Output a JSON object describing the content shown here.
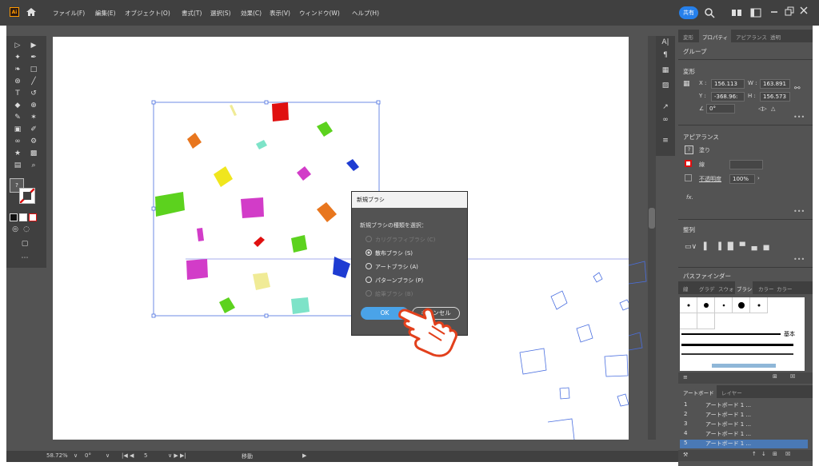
{
  "menubar": {
    "logo": "Ai",
    "items": [
      "ファイル(F)",
      "編集(E)",
      "オブジェクト(O)",
      "書式(T)",
      "選択(S)",
      "効果(C)",
      "表示(V)",
      "ウィンドウ(W)",
      "ヘルプ(H)"
    ],
    "share_label": "共有"
  },
  "dialog": {
    "title": "新規ブラシ",
    "prompt": "新規ブラシの種類を選択：",
    "options": [
      {
        "label": "カリグラフィブラシ (C)",
        "enabled": false,
        "selected": false
      },
      {
        "label": "散布ブラシ (S)",
        "enabled": true,
        "selected": true
      },
      {
        "label": "アートブラシ (A)",
        "enabled": true,
        "selected": false
      },
      {
        "label": "パターンブラシ (P)",
        "enabled": true,
        "selected": false
      },
      {
        "label": "絵筆ブラシ (B)",
        "enabled": false,
        "selected": false
      }
    ],
    "ok_label": "OK",
    "cancel_label": "キャンセル"
  },
  "properties_panel": {
    "tabs": [
      "変形",
      "プロパティ",
      "アピアランス",
      "透明"
    ],
    "active_tab": "プロパティ",
    "group_label": "グループ",
    "transform_title": "変形",
    "x_label": "X :",
    "x_value": "156.113",
    "y_label": "Y :",
    "y_value": "-368.96:",
    "w_label": "W :",
    "w_value": "163.891",
    "h_label": "H :",
    "h_value": "156.573",
    "angle_value": "0°",
    "appearance_title": "アピアランス",
    "fill_label": "塗り",
    "stroke_label": "線",
    "opacity_label": "不透明度",
    "opacity_value": "100%",
    "fx_label": "fx.",
    "align_title": "整列",
    "pathfinder_title": "パスファインダー"
  },
  "brush_panel": {
    "tabs": [
      "線",
      "グラデ",
      "スウォ",
      "ブラシ",
      "カラー",
      "カラー"
    ],
    "active_tab": "ブラシ",
    "basic_label": "基本"
  },
  "layers_panel": {
    "tabs": [
      "アートボード",
      "レイヤー"
    ],
    "rows": [
      {
        "num": "1",
        "name": "アートボード 1 ..."
      },
      {
        "num": "2",
        "name": "アートボード 1 ..."
      },
      {
        "num": "3",
        "name": "アートボード 1 ..."
      },
      {
        "num": "4",
        "name": "アートボード 1 ..."
      },
      {
        "num": "5",
        "name": "アートボード 1 ..."
      }
    ],
    "selected_index": 4
  },
  "statusbar": {
    "zoom": "58.72%",
    "rotation": "0°",
    "artboard_num": "5",
    "tool_name": "移動"
  },
  "colors": {
    "accent": "#2680eb",
    "selection": "#4a6fe0",
    "confetti": [
      "#e8761e",
      "#e01010",
      "#5cd21e",
      "#7de3c8",
      "#f0e61e",
      "#d23cc8",
      "#1e3cd2",
      "#f0eb96"
    ]
  }
}
